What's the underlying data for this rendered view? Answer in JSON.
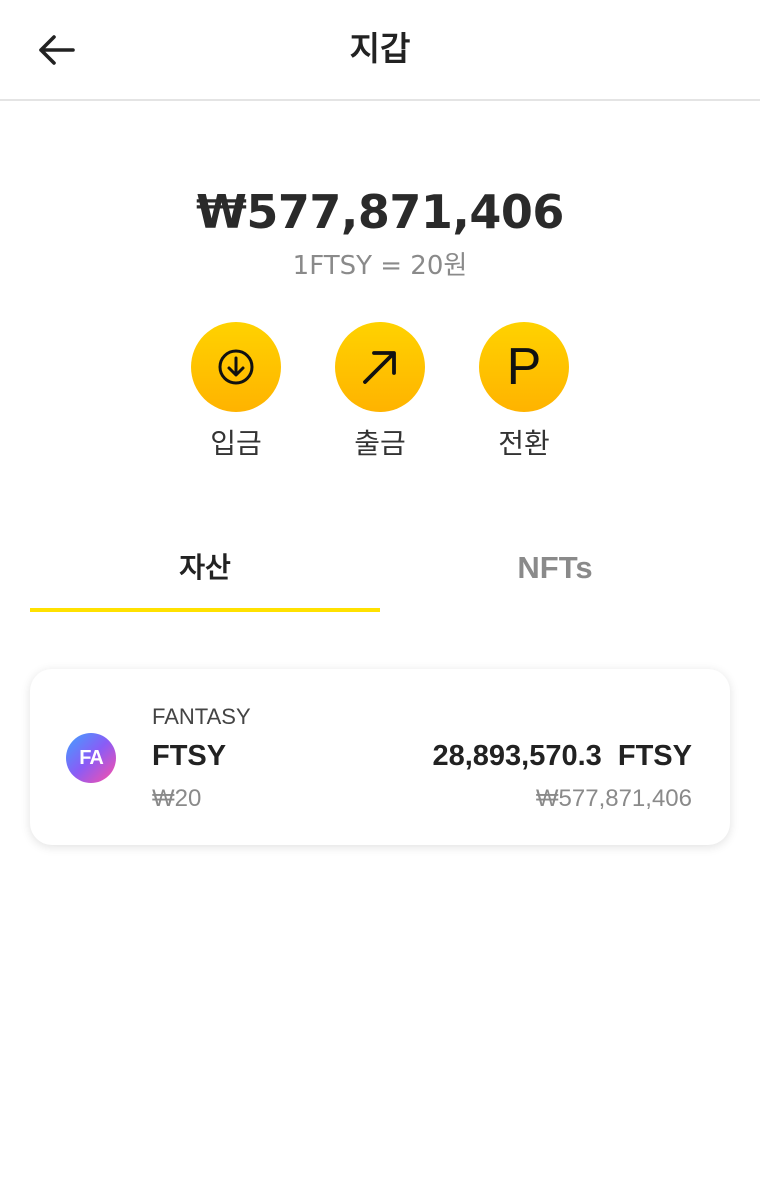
{
  "header": {
    "title": "지갑",
    "back_icon": "arrow-left-icon"
  },
  "wallet": {
    "balance": "₩577,871,406",
    "rate": "1FTSY = 20원"
  },
  "actions": [
    {
      "label": "입금",
      "icon": "download-circle-icon"
    },
    {
      "label": "출금",
      "icon": "arrow-up-right-icon"
    },
    {
      "label": "전환",
      "icon": "p-letter-icon"
    }
  ],
  "tabs": [
    {
      "label": "자산",
      "active": true
    },
    {
      "label": "NFTs",
      "active": false
    }
  ],
  "assets": [
    {
      "logo_text": "FA",
      "full_name": "FANTASY",
      "symbol": "FTSY",
      "price": "₩20",
      "amount": "28,893,570.3  FTSY",
      "value": "₩577,871,406"
    }
  ],
  "colors": {
    "accent": "#ffd200",
    "accent_dark": "#ffb300",
    "tab_underline": "#ffe100",
    "muted_text": "#8a8a8a"
  }
}
